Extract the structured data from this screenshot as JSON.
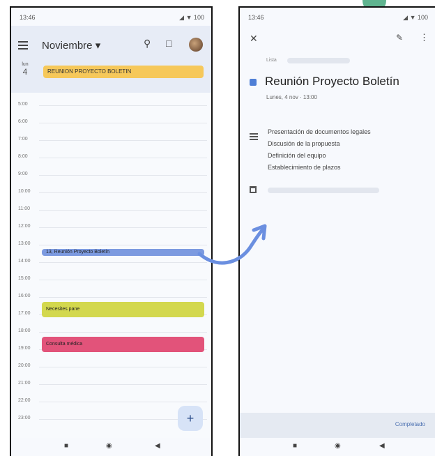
{
  "status": {
    "time": "13:46",
    "icons": "◢ ▼ 100"
  },
  "calendar": {
    "month": "Noviembre",
    "day_name": "lun",
    "day_number": "4",
    "allday_event": "REUNION PROYECTO BOLETIN",
    "hours": [
      "5:00",
      "6:00",
      "7:00",
      "8:00",
      "9:00",
      "10:00",
      "11:00",
      "12:00",
      "13:00",
      "14:00",
      "15:00",
      "16:00",
      "17:00",
      "18:00",
      "19:00",
      "20:00",
      "21:00",
      "22:00",
      "23:00"
    ],
    "events": [
      {
        "label": "13, Reunión Proyecto Boletín",
        "color": "#7c9ae0"
      },
      {
        "label": "Necesites pane",
        "color": "#d3d84e"
      },
      {
        "label": "Consulta médica",
        "color": "#e2537a"
      }
    ],
    "fab": "+"
  },
  "detail": {
    "small_label": "Lista",
    "title": "Reunión Proyecto Boletín",
    "date": "Lunes, 4 nov · 13:00",
    "description": [
      "Presentación de documentos legales",
      "Discusión de la propuesta",
      "Definición del equipo",
      "Establecimiento de plazos"
    ],
    "done_label": "Completado"
  },
  "icons": {
    "menu": "menu-icon",
    "search": "search-icon",
    "today": "today-icon",
    "close": "close-icon",
    "edit": "pencil-icon",
    "more": "more-vert-icon",
    "description": "description-icon",
    "calendar": "calendar-icon"
  },
  "colors": {
    "allday": "#f6c85a",
    "accent": "#4f7fd6",
    "arrow": "#6b8fe0"
  }
}
